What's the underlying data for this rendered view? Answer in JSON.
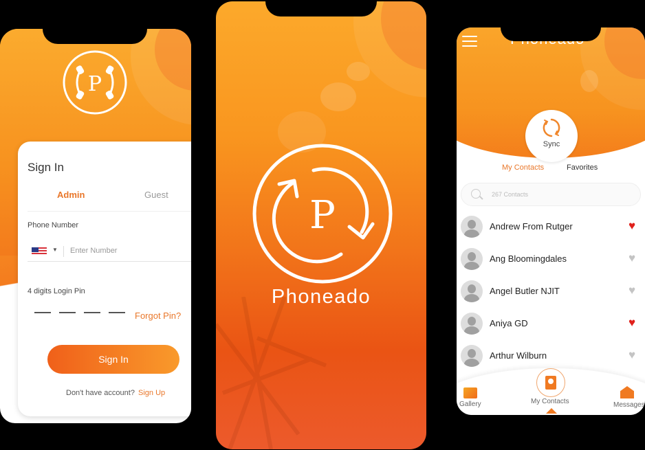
{
  "signin_screen": {
    "title": "Sign In",
    "tabs": [
      {
        "label": "Admin",
        "active": true
      },
      {
        "label": "Guest",
        "active": false
      }
    ],
    "phone_label": "Phone Number",
    "country_flag": "us-flag-icon",
    "phone_placeholder": "Enter Number",
    "pin_label": "4 digits Login Pin",
    "pin_digits": 4,
    "forgot_pin": "Forgot Pin?",
    "sign_in_button": "Sign In",
    "no_account_text": "Don't have account?",
    "sign_up_link": "Sign Up"
  },
  "splash_screen": {
    "brand_name": "Phoneado"
  },
  "contacts_screen": {
    "title": "Phoneado",
    "sync_label": "Sync",
    "tabs": [
      {
        "label": "My Contacts",
        "active": true
      },
      {
        "label": "Favorites",
        "active": false
      }
    ],
    "search_placeholder": "267 Contacts",
    "contacts": [
      {
        "name": "Andrew From Rutger",
        "favorite": true
      },
      {
        "name": "Ang Bloomingdales",
        "favorite": false
      },
      {
        "name": "Angel Butler NJIT",
        "favorite": false
      },
      {
        "name": "Aniya GD",
        "favorite": true
      },
      {
        "name": "Arthur Wilburn",
        "favorite": false
      }
    ],
    "bottom_nav": [
      {
        "label": "Gallery",
        "icon": "gallery-icon"
      },
      {
        "label": "My Contacts",
        "icon": "contacts-book-icon",
        "active": true
      },
      {
        "label": "Messages",
        "icon": "messages-icon"
      }
    ]
  },
  "colors": {
    "accent": "#e9772a",
    "gradient_start": "#fbab2e",
    "gradient_end": "#ea5414",
    "favorite_on": "#e0201b",
    "favorite_off": "#c4c4c4"
  }
}
